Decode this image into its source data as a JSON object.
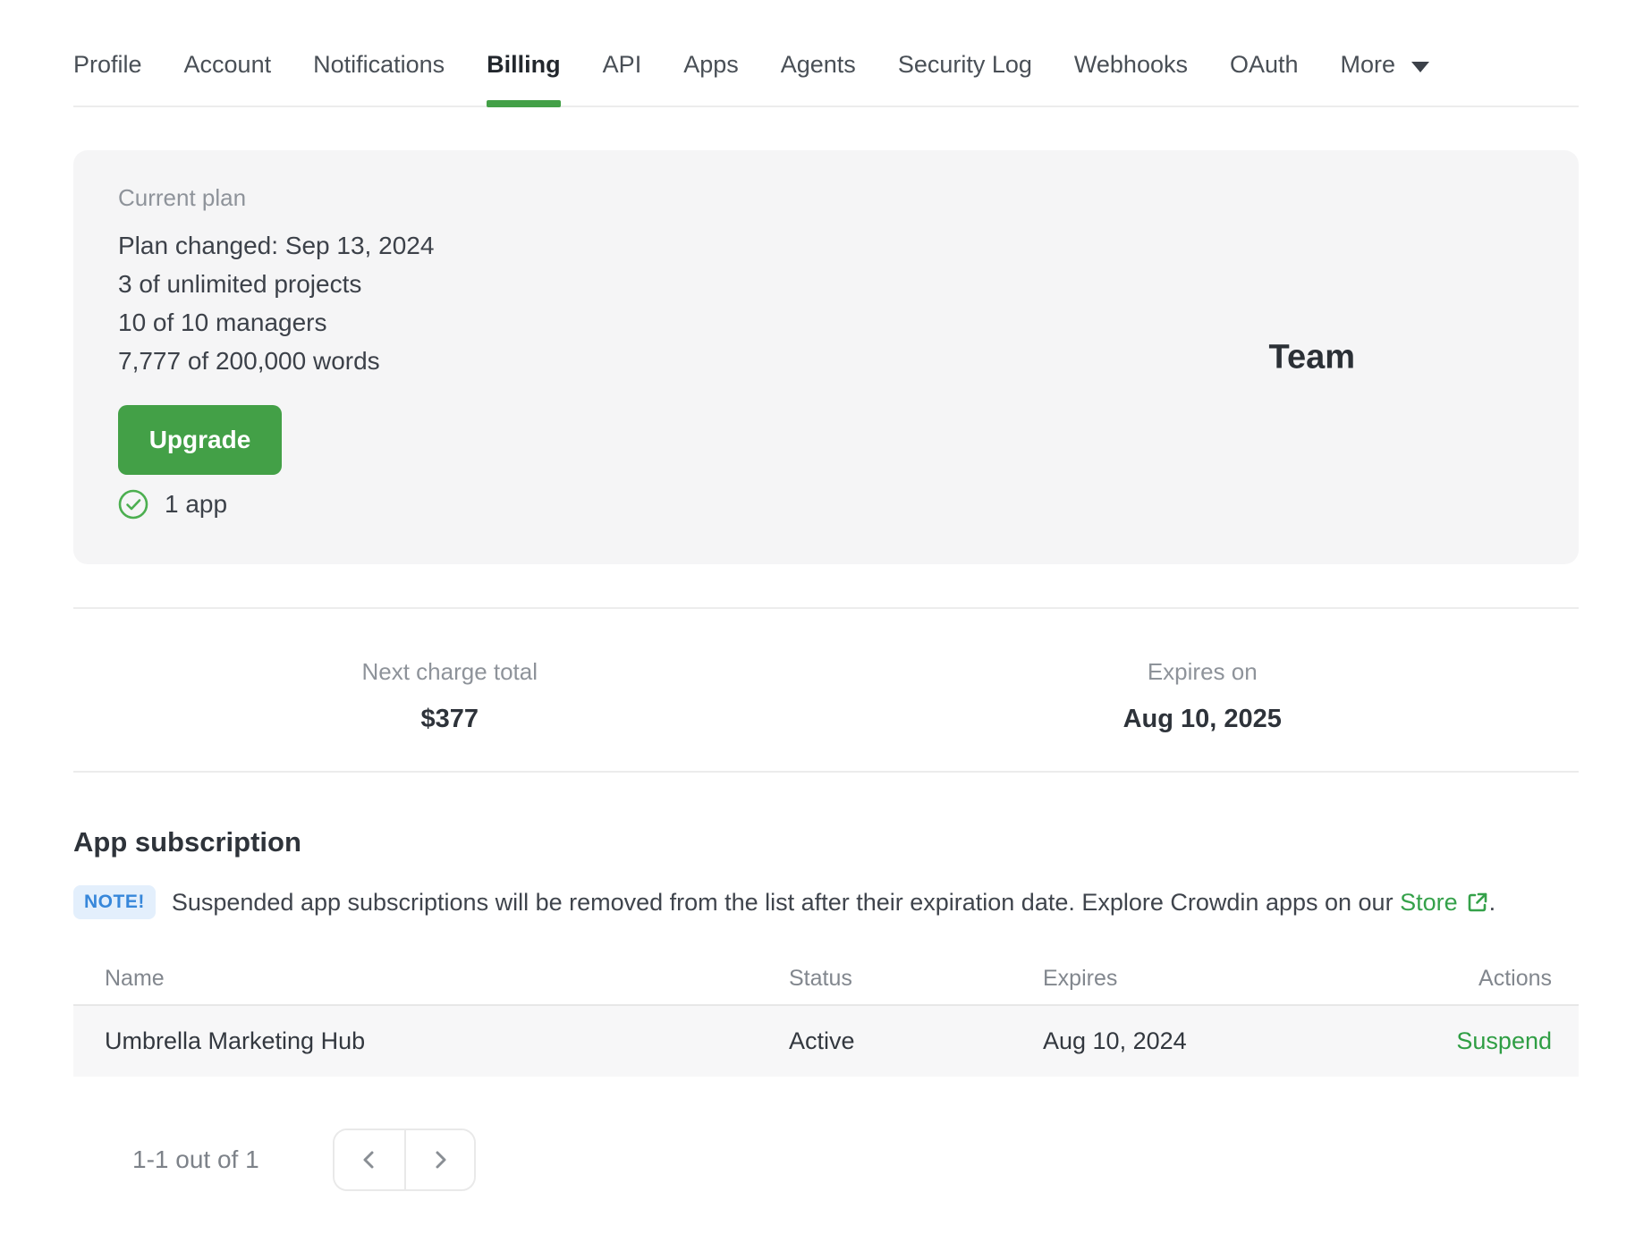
{
  "nav": {
    "tabs": [
      {
        "label": "Profile"
      },
      {
        "label": "Account"
      },
      {
        "label": "Notifications"
      },
      {
        "label": "Billing",
        "active": true
      },
      {
        "label": "API"
      },
      {
        "label": "Apps"
      },
      {
        "label": "Agents"
      },
      {
        "label": "Security Log"
      },
      {
        "label": "Webhooks"
      },
      {
        "label": "OAuth"
      },
      {
        "label": "More"
      }
    ]
  },
  "plan_card": {
    "label": "Current plan",
    "details": {
      "changed": "Plan changed: Sep 13, 2024",
      "projects": "3 of unlimited projects",
      "managers": "10 of 10 managers",
      "words": "7,777 of 200,000 words"
    },
    "upgrade_label": "Upgrade",
    "apps_count": "1 app",
    "plan_name": "Team"
  },
  "billing_summary": {
    "next_charge": {
      "label": "Next charge total",
      "value": "$377"
    },
    "expires": {
      "label": "Expires on",
      "value": "Aug 10, 2025"
    }
  },
  "subscriptions": {
    "title": "App subscription",
    "note_badge": "NOTE!",
    "note_text": "Suspended app subscriptions will be removed from the list after their expiration date. Explore Crowdin apps on our",
    "note_link": "Store",
    "note_suffix": ".",
    "table": {
      "columns": {
        "name": "Name",
        "status": "Status",
        "expires": "Expires",
        "actions": "Actions"
      },
      "rows": [
        {
          "name": "Umbrella Marketing Hub",
          "status": "Active",
          "expires": "Aug 10, 2024",
          "action": "Suspend"
        }
      ]
    },
    "pagination": {
      "label": "1-1 out of 1"
    }
  },
  "colors": {
    "accent_green": "#43a047",
    "link_green": "#2f9e44",
    "note_blue": "#3787da",
    "note_bg": "#e3effc",
    "card_bg": "#f5f5f6"
  }
}
